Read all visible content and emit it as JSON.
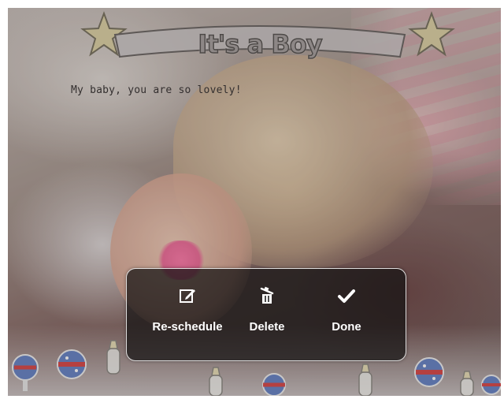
{
  "frame": {
    "banner_title": "It's a Boy",
    "caption": "My baby, you are so lovely!"
  },
  "menu": {
    "items": [
      {
        "label": "Re-schedule",
        "icon": "edit-icon"
      },
      {
        "label": "Delete",
        "icon": "trash-icon"
      },
      {
        "label": "Done",
        "icon": "checkmark-icon"
      }
    ]
  },
  "colors": {
    "menu_background": "#141212",
    "menu_border": "#ffffff",
    "label_text": "#ffffff"
  }
}
